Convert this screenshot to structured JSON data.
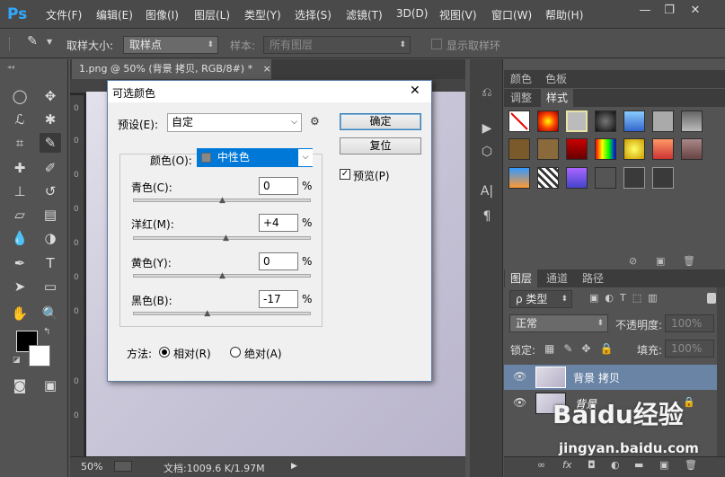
{
  "app": {
    "logo": "Ps"
  },
  "menu": [
    "文件(F)",
    "编辑(E)",
    "图像(I)",
    "图层(L)",
    "类型(Y)",
    "选择(S)",
    "滤镜(T)",
    "3D(D)",
    "视图(V)",
    "窗口(W)",
    "帮助(H)"
  ],
  "window_controls": {
    "minimize": "—",
    "restore": "❐",
    "close": "✕"
  },
  "options_bar": {
    "sample_size_label": "取样大小:",
    "sample_size_value": "取样点",
    "sample_label": "样本:",
    "sample_value": "所有图层",
    "show_ring_label": "显示取样环"
  },
  "document": {
    "tab_title": "1.png @ 50% (背景 拷贝, RGB/8#) *",
    "close_glyph": "×",
    "ruler_numbers": [
      "0",
      "0",
      "0",
      "0",
      "0",
      "0",
      "0",
      "0",
      "0"
    ],
    "status_zoom": "50%",
    "status_doc": "文档:1009.6 K/1.97M",
    "status_arrow": "▶"
  },
  "dialog": {
    "title": "可选颜色",
    "close_glyph": "✕",
    "preset_label": "预设(E):",
    "preset_value": "自定",
    "ok_label": "确定",
    "reset_label": "复位",
    "preview_label": "预览(P)",
    "preview_checked": true,
    "colors_label": "颜色(O):",
    "colors_value": "中性色",
    "sliders": [
      {
        "label": "青色(C):",
        "value": "0",
        "unit": "%",
        "level": 0.5
      },
      {
        "label": "洋红(M):",
        "value": "+4",
        "unit": "%",
        "level": 0.52
      },
      {
        "label": "黄色(Y):",
        "value": "0",
        "unit": "%",
        "level": 0.5
      },
      {
        "label": "黑色(B):",
        "value": "-17",
        "unit": "%",
        "level": 0.415
      }
    ],
    "method_label": "方法:",
    "method_relative": "相对(R)",
    "method_absolute": "绝对(A)",
    "method_selected": "relative"
  },
  "panels": {
    "top_tabs_row1": [
      "颜色",
      "色板"
    ],
    "top_tabs_row2": [
      "调整",
      "样式"
    ],
    "layers_tabs": [
      "图层",
      "通道",
      "路径"
    ],
    "kind_filter": "ρ 类型",
    "blend_mode": "正常",
    "opacity_label": "不透明度:",
    "opacity_value": "100%",
    "lock_label": "锁定:",
    "fill_label": "填充:",
    "fill_value": "100%",
    "layers": [
      {
        "name": "背景 拷贝",
        "selected": true
      },
      {
        "name": "背景",
        "selected": false,
        "locked": true
      }
    ],
    "bottom_icons": [
      "∞",
      "fx",
      "◘",
      "◐",
      "▬",
      "▣",
      "🗑"
    ]
  },
  "watermark": {
    "brand": "Baidu经验",
    "url": "jingyan.baidu.com"
  },
  "colors": {
    "accent_blue": "#3399ff",
    "selected_layer": "#6a84a6",
    "panel_bg": "#535353"
  }
}
